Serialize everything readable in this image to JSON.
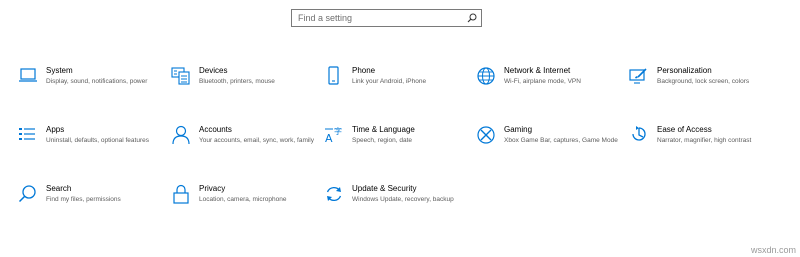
{
  "search": {
    "placeholder": "Find a setting",
    "icon": "search-icon"
  },
  "accent_color": "#0078d7",
  "tiles": [
    {
      "title": "System",
      "desc": "Display, sound, notifications, power",
      "icon": "laptop-icon"
    },
    {
      "title": "Devices",
      "desc": "Bluetooth, printers, mouse",
      "icon": "keyboard-icon"
    },
    {
      "title": "Phone",
      "desc": "Link your Android, iPhone",
      "icon": "phone-icon"
    },
    {
      "title": "Network & Internet",
      "desc": "Wi-Fi, airplane mode, VPN",
      "icon": "globe-icon"
    },
    {
      "title": "Personalization",
      "desc": "Background, lock screen, colors",
      "icon": "paint-icon"
    },
    {
      "title": "Apps",
      "desc": "Uninstall, defaults, optional features",
      "icon": "list-icon"
    },
    {
      "title": "Accounts",
      "desc": "Your accounts, email, sync, work, family",
      "icon": "person-icon"
    },
    {
      "title": "Time & Language",
      "desc": "Speech, region, date",
      "icon": "time-language-icon"
    },
    {
      "title": "Gaming",
      "desc": "Xbox Game Bar, captures, Game Mode",
      "icon": "xbox-icon"
    },
    {
      "title": "Ease of Access",
      "desc": "Narrator, magnifier, high contrast",
      "icon": "ease-of-access-icon"
    },
    {
      "title": "Search",
      "desc": "Find my files, permissions",
      "icon": "magnifier-icon"
    },
    {
      "title": "Privacy",
      "desc": "Location, camera, microphone",
      "icon": "lock-icon"
    },
    {
      "title": "Update & Security",
      "desc": "Windows Update, recovery, backup",
      "icon": "sync-icon"
    }
  ],
  "watermark": "wsxdn.com"
}
